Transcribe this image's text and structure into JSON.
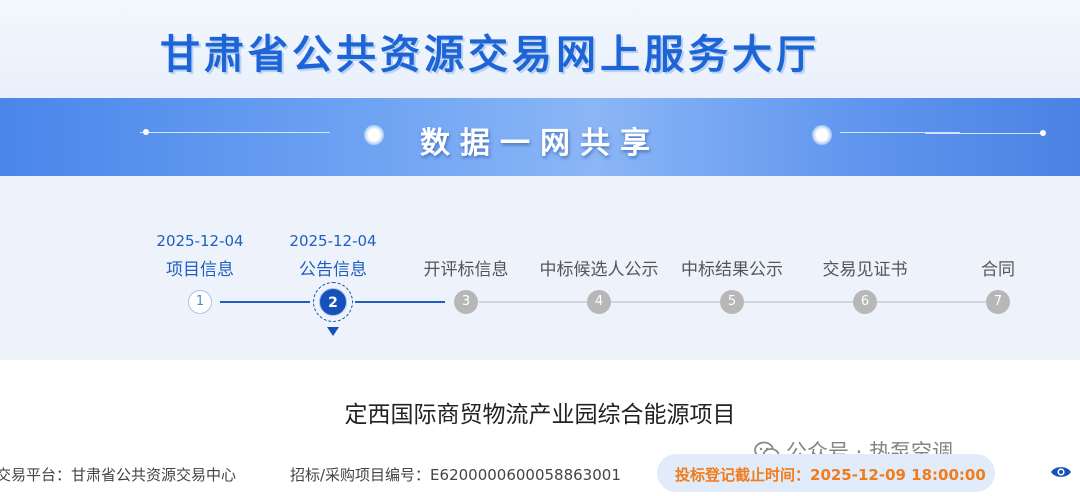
{
  "header": {
    "site_title": "甘肃省公共资源交易网上服务大厅",
    "slogan": "数据一网共享"
  },
  "progress": {
    "steps": [
      {
        "number": "1",
        "date": "2025-12-04",
        "label": "项目信息",
        "state": "done"
      },
      {
        "number": "2",
        "date": "2025-12-04",
        "label": "公告信息",
        "state": "active"
      },
      {
        "number": "3",
        "date": "",
        "label": "开评标信息",
        "state": "pending"
      },
      {
        "number": "4",
        "date": "",
        "label": "中标候选人公示",
        "state": "pending"
      },
      {
        "number": "5",
        "date": "",
        "label": "中标结果公示",
        "state": "pending"
      },
      {
        "number": "6",
        "date": "",
        "label": "交易见证书",
        "state": "pending"
      },
      {
        "number": "7",
        "date": "",
        "label": "合同",
        "state": "pending"
      }
    ]
  },
  "project": {
    "title": "定西国际商贸物流产业园综合能源项目",
    "platform": "交易平台：甘肃省公共资源交易中心",
    "code": "招标/采购项目编号：E6200000600058863001",
    "deadline": "投标登记截止时间：2025-12-09 18:00:00"
  },
  "watermark": {
    "text": "公众号 · 热泵空调"
  },
  "colors": {
    "brand_blue": "#1d64d6",
    "active_step": "#1651b8",
    "pending_step": "#b7b7b7",
    "deadline_text": "#f07c1a"
  }
}
